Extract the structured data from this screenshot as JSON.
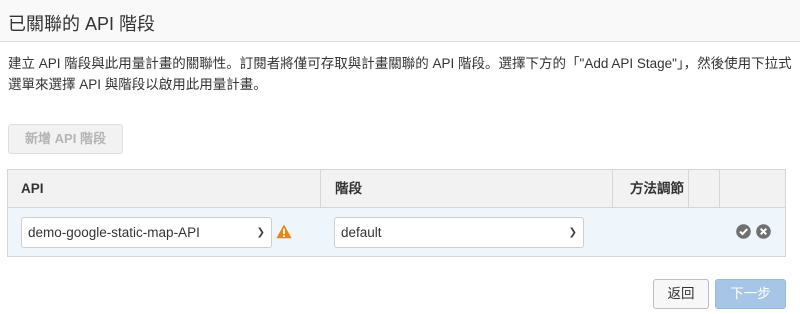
{
  "header": {
    "title": "已關聯的 API 階段"
  },
  "description": "建立 API 階段與此用量計畫的關聯性。訂閱者將僅可存取與計畫關聯的 API 階段。選擇下方的「\"Add API Stage\"」，然後使用下拉式選單來選擇 API 與階段以啟用此用量計畫。",
  "toolbar": {
    "add_stage_label": "新增 API 階段"
  },
  "table": {
    "columns": [
      "API",
      "階段",
      "方法調節"
    ],
    "rows": [
      {
        "api": "demo-google-static-map-API",
        "stage": "default"
      }
    ]
  },
  "footer": {
    "back_label": "返回",
    "next_label": "下一步"
  },
  "colors": {
    "warning": "#e8841a",
    "row_highlight": "#eef5fb",
    "next_button": "#a7c5e6",
    "icon_gray": "#707070"
  }
}
